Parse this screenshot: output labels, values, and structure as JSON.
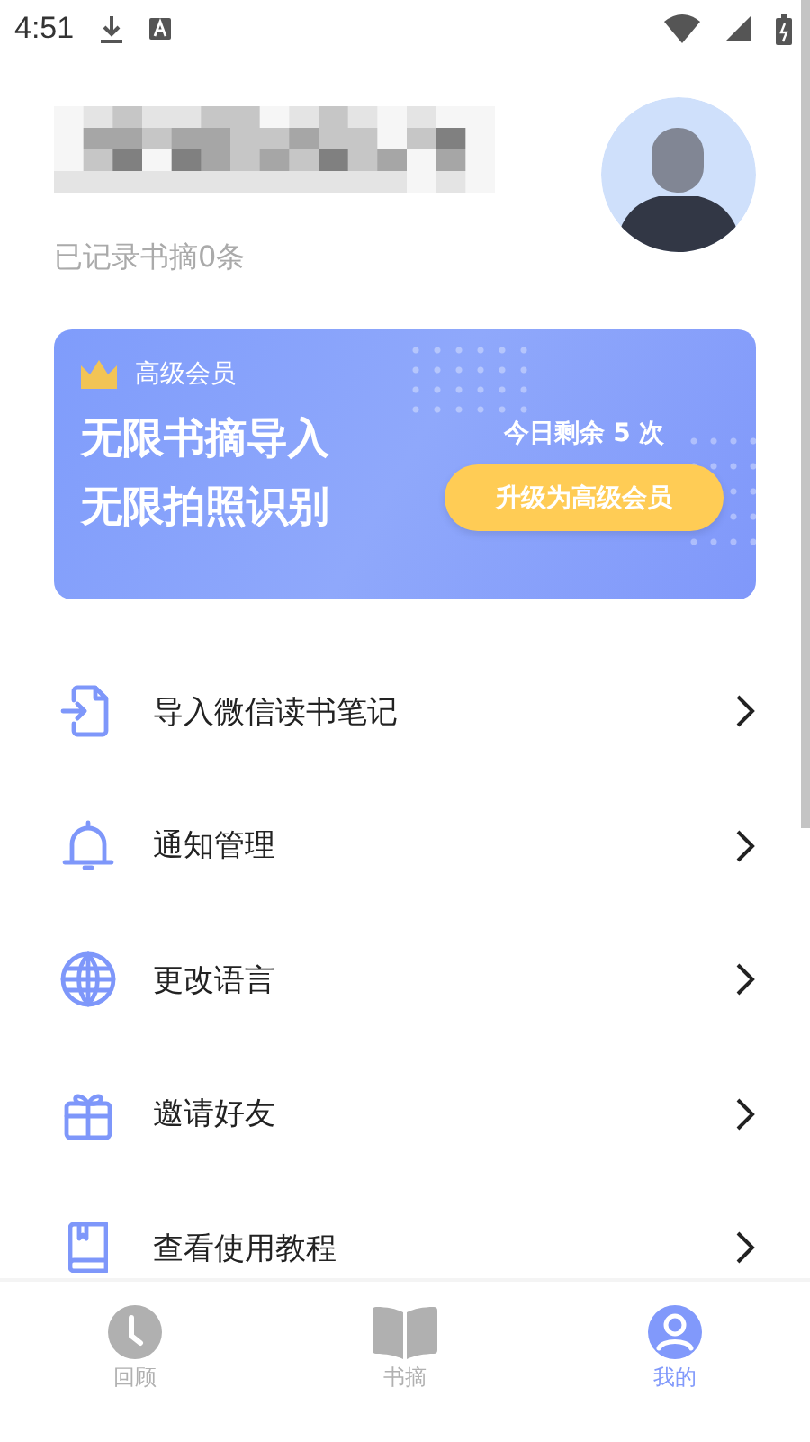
{
  "status_bar": {
    "time": "4:51"
  },
  "profile": {
    "subtitle": "已记录书摘0条"
  },
  "banner": {
    "badge": "高级会员",
    "lines": [
      "无限书摘导入",
      "无限拍照识别"
    ],
    "remaining": "今日剩余 5 次",
    "button": "升级为高级会员"
  },
  "menu": [
    {
      "kind": "import",
      "label": "导入微信读书笔记"
    },
    {
      "kind": "bell",
      "label": "通知管理"
    },
    {
      "kind": "globe",
      "label": "更改语言"
    },
    {
      "kind": "gift",
      "label": "邀请好友"
    },
    {
      "kind": "book",
      "label": "查看使用教程"
    }
  ],
  "tabs": [
    {
      "kind": "clock",
      "label": "回顾",
      "selected": false
    },
    {
      "kind": "book",
      "label": "书摘",
      "selected": false
    },
    {
      "kind": "user",
      "label": "我的",
      "selected": true
    }
  ]
}
